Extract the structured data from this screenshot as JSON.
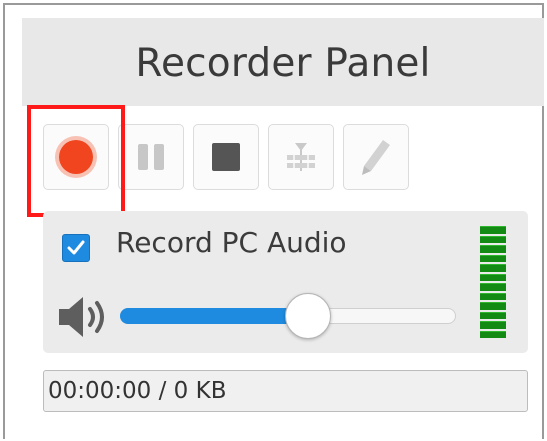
{
  "panel": {
    "title": "Recorder Panel"
  },
  "toolbar": {
    "buttons": [
      {
        "name": "record",
        "icon": "record-icon",
        "enabled": true,
        "color": "#f0451f",
        "highlighted": true
      },
      {
        "name": "pause",
        "icon": "pause-icon",
        "enabled": false
      },
      {
        "name": "stop",
        "icon": "stop-icon",
        "enabled": true
      },
      {
        "name": "trim",
        "icon": "trim-icon",
        "enabled": false
      },
      {
        "name": "edit",
        "icon": "pencil-icon",
        "enabled": false
      }
    ],
    "highlight_color": "#ff1a1a"
  },
  "audio": {
    "record_pc_audio_checked": true,
    "record_pc_audio_label": "Record PC Audio",
    "volume_fraction": 0.56,
    "accent_color": "#1e8be0",
    "speaker_icon": "speaker-volume-icon",
    "level_meter_segments": 12,
    "level_meter_color": "#138a13"
  },
  "status": {
    "value": "00:00:00 / 0 KB"
  }
}
